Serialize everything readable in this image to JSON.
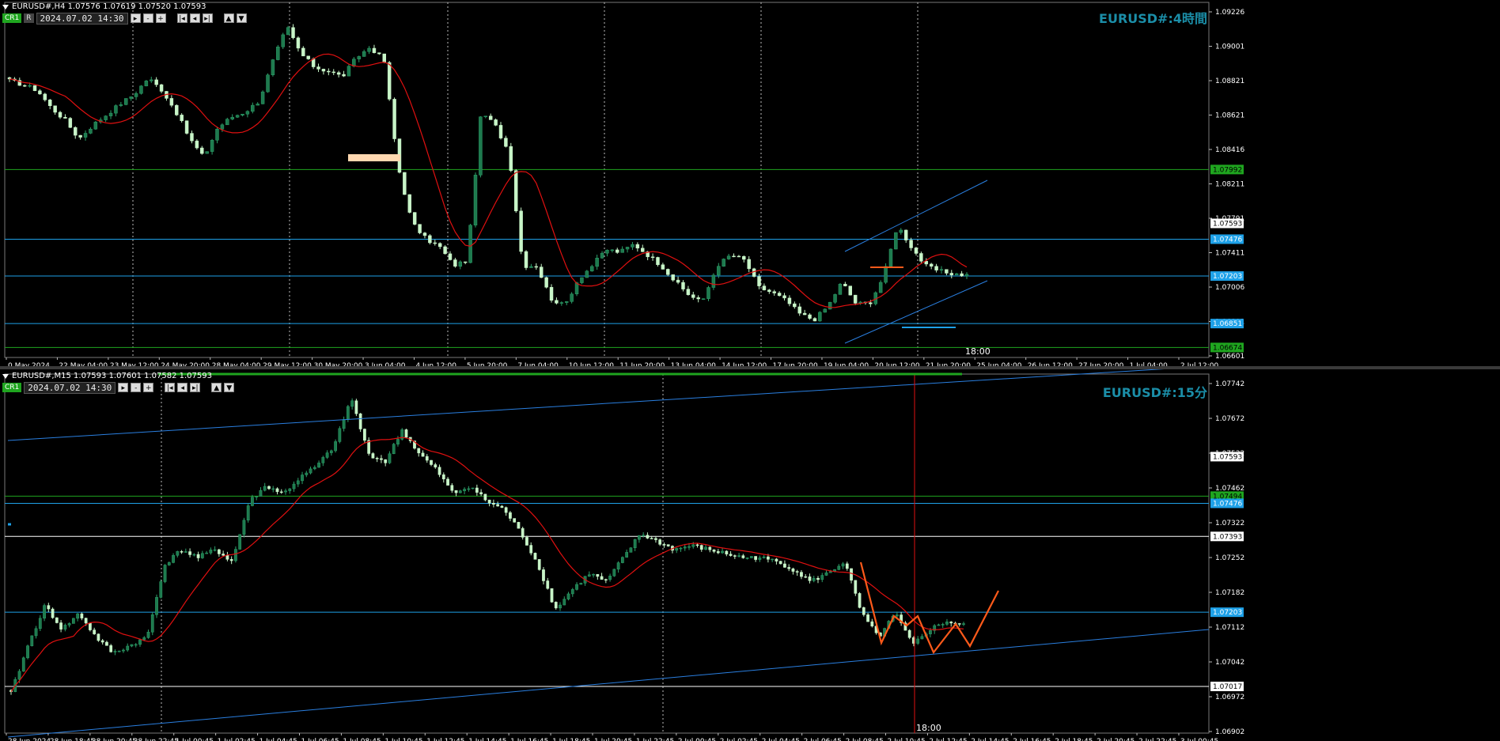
{
  "h4": {
    "symbol_line": "EURUSD#,H4  1.07576 1.07619 1.07520 1.07593",
    "datetime": "2024.07.02  14:30",
    "title": "EURUSD#:4時間",
    "marker_label": "18:00",
    "price_ticks": [
      "1.09226",
      "1.09001",
      "1.08821",
      "1.08621",
      "1.08416",
      "1.08211",
      "1.07791",
      "1.07411",
      "1.07006",
      "1.06801",
      "1.06601"
    ],
    "price_tags": [
      {
        "label": "1.07992",
        "value": 1.07992,
        "color": "#1fa51f",
        "text_color": "#000"
      },
      {
        "label": "1.07593",
        "value": 1.07593,
        "color": "#ffffff",
        "text_color": "#000"
      },
      {
        "label": "1.07476",
        "value": 1.07476,
        "color": "#1ea1e8",
        "text_color": "#fff"
      },
      {
        "label": "1.07203",
        "value": 1.07203,
        "color": "#1ea1e8",
        "text_color": "#fff"
      },
      {
        "label": "1.06851",
        "value": 1.06851,
        "color": "#1ea1e8",
        "text_color": "#fff"
      },
      {
        "label": "1.06674",
        "value": 1.06674,
        "color": "#1fa51f",
        "text_color": "#000"
      }
    ],
    "time_ticks": [
      "0 May 2024",
      "22 May 04:00",
      "23 May 12:00",
      "24 May 20:00",
      "28 May 04:00",
      "29 May 12:00",
      "30 May 20:00",
      "3 Jun 04:00",
      "4 Jun 12:00",
      "5 Jun 20:00",
      "7 Jun 04:00",
      "10 Jun 12:00",
      "11 Jun 20:00",
      "13 Jun 04:00",
      "14 Jun 12:00",
      "17 Jun 20:00",
      "19 Jun 04:00",
      "20 Jun 12:00",
      "21 Jun 20:00",
      "25 Jun 04:00",
      "26 Jun 12:00",
      "27 Jun 20:00",
      "1 Jul 04:00",
      "2 Jul 12:00"
    ]
  },
  "m15": {
    "symbol_line": "EURUSD#,M15  1.07593 1.07601 1.07582 1.07593",
    "datetime": "2024.07.02  14:30",
    "title": "EURUSD#:15分",
    "marker_label": "18:00",
    "price_ticks": [
      "1.07742",
      "1.07672",
      "1.07532",
      "1.07462",
      "1.07322",
      "1.07252",
      "1.07182",
      "1.07112",
      "1.07042",
      "1.06972",
      "1.06902"
    ],
    "price_tags": [
      {
        "label": "1.07593",
        "value": 1.07593,
        "color": "#ffffff",
        "text_color": "#000"
      },
      {
        "label": "1.07494",
        "value": 1.07494,
        "color": "#1fa51f",
        "text_color": "#000"
      },
      {
        "label": "1.07476",
        "value": 1.07476,
        "color": "#1ea1e8",
        "text_color": "#fff"
      },
      {
        "label": "1.07393",
        "value": 1.07393,
        "color": "#ffffff",
        "text_color": "#000"
      },
      {
        "label": "1.07203",
        "value": 1.07203,
        "color": "#1ea1e8",
        "text_color": "#fff"
      },
      {
        "label": "1.07017",
        "value": 1.07017,
        "color": "#ffffff",
        "text_color": "#000"
      }
    ],
    "time_ticks": [
      "28 Jun 2024",
      "28 Jun 18:45",
      "28 Jun 20:45",
      "28 Jun 22:45",
      "1 Jul 00:45",
      "1 Jul 02:45",
      "1 Jul 04:45",
      "1 Jul 06:45",
      "1 Jul 08:45",
      "1 Jul 10:45",
      "1 Jul 12:45",
      "1 Jul 14:45",
      "1 Jul 16:45",
      "1 Jul 18:45",
      "1 Jul 20:45",
      "1 Jul 22:45",
      "2 Jul 00:45",
      "2 Jul 02:45",
      "2 Jul 04:45",
      "2 Jul 06:45",
      "2 Jul 08:45",
      "2 Jul 10:45",
      "2 Jul 12:45",
      "2 Jul 14:45",
      "2 Jul 16:45",
      "2 Jul 18:45",
      "2 Jul 20:45",
      "2 Jul 22:45",
      "3 Jul 00:45"
    ]
  },
  "toolbar": {
    "cr_label": "CR1",
    "r_label": "R"
  },
  "colors": {
    "bull": "#1e7a4e",
    "bear": "#c8f5c8",
    "ma": "#e01010",
    "trend": "#2a7fe0",
    "hline_blue": "#1ea1e8",
    "hline_green": "#1fa51f",
    "zigzag": "#ff5a1a",
    "title": "#1b8ea8"
  },
  "chart_data": [
    {
      "type": "candlestick",
      "title": "EURUSD#:4時間",
      "symbol": "EURUSD#",
      "timeframe": "H4",
      "ylim": [
        1.066,
        1.0923
      ],
      "grid": false,
      "x_tick_labels": [
        "0 May 2024",
        "22 May 04:00",
        "23 May 12:00",
        "24 May 20:00",
        "28 May 04:00",
        "29 May 12:00",
        "30 May 20:00",
        "3 Jun 04:00",
        "4 Jun 12:00",
        "5 Jun 20:00",
        "7 Jun 04:00",
        "10 Jun 12:00",
        "11 Jun 20:00",
        "13 Jun 04:00",
        "14 Jun 12:00",
        "17 Jun 20:00",
        "19 Jun 04:00",
        "20 Jun 12:00",
        "21 Jun 20:00",
        "25 Jun 04:00",
        "26 Jun 12:00",
        "27 Jun 20:00",
        "1 Jul 04:00",
        "2 Jul 12:00"
      ],
      "series": [
        {
          "name": "EURUSD#,H4",
          "anchors": [
            1.0865,
            1.0862,
            1.0858,
            1.0845,
            1.0836,
            1.0822,
            1.0832,
            1.084,
            1.0848,
            1.0855,
            1.0867,
            1.0858,
            1.0842,
            1.0822,
            1.0808,
            1.083,
            1.0838,
            1.0842,
            1.085,
            1.088,
            1.0905,
            1.0885,
            1.0875,
            1.0872,
            1.0868,
            1.0882,
            1.089,
            1.088,
            1.0802,
            1.076,
            1.0748,
            1.0742,
            1.0728,
            1.0732,
            1.0842,
            1.0832,
            1.0812,
            1.0728,
            1.0728,
            1.0704,
            1.0698,
            1.0718,
            1.0728,
            1.074,
            1.0738,
            1.0744,
            1.0736,
            1.0728,
            1.0716,
            1.0706,
            1.0702,
            1.0728,
            1.0736,
            1.0732,
            1.0712,
            1.0708,
            1.0702,
            1.0692,
            1.0688,
            1.0698,
            1.0716,
            1.07,
            1.07,
            1.072,
            1.0758,
            1.0742,
            1.0728,
            1.0724,
            1.0722,
            1.0721
          ]
        }
      ],
      "horizontal_lines": [
        1.07992,
        1.07476,
        1.07203,
        1.06851,
        1.06674
      ],
      "last_price": 1.07593
    },
    {
      "type": "candlestick",
      "title": "EURUSD#:15分",
      "symbol": "EURUSD#",
      "timeframe": "M15",
      "ylim": [
        1.069,
        1.078
      ],
      "grid": false,
      "x_tick_labels": [
        "28 Jun 2024",
        "28 Jun 18:45",
        "28 Jun 20:45",
        "28 Jun 22:45",
        "1 Jul 00:45",
        "1 Jul 02:45",
        "1 Jul 04:45",
        "1 Jul 06:45",
        "1 Jul 08:45",
        "1 Jul 10:45",
        "1 Jul 12:45",
        "1 Jul 14:45",
        "1 Jul 16:45",
        "1 Jul 18:45",
        "1 Jul 20:45",
        "1 Jul 22:45",
        "2 Jul 00:45",
        "2 Jul 02:45",
        "2 Jul 04:45",
        "2 Jul 06:45",
        "2 Jul 08:45",
        "2 Jul 10:45",
        "2 Jul 12:45",
        "2 Jul 14:45",
        "2 Jul 16:45",
        "2 Jul 18:45",
        "2 Jul 20:45",
        "2 Jul 22:45",
        "3 Jul 00:45"
      ],
      "series": [
        {
          "name": "EURUSD#,M15",
          "anchors": [
            1.07,
            1.0712,
            1.0722,
            1.0716,
            1.072,
            1.0714,
            1.071,
            1.0712,
            1.0714,
            1.0732,
            1.0736,
            1.0734,
            1.0736,
            1.0733,
            1.0748,
            1.0752,
            1.075,
            1.0754,
            1.0757,
            1.0762,
            1.0774,
            1.076,
            1.0758,
            1.0766,
            1.076,
            1.0756,
            1.075,
            1.0752,
            1.0748,
            1.0746,
            1.074,
            1.0732,
            1.0721,
            1.0726,
            1.073,
            1.0728,
            1.0734,
            1.074,
            1.0738,
            1.0736,
            1.0737,
            1.0736,
            1.0735,
            1.0734,
            1.0734,
            1.0733,
            1.0731,
            1.0728,
            1.073,
            1.0733,
            1.072,
            1.0714,
            1.072,
            1.0712,
            1.0716,
            1.0718,
            1.0717
          ]
        }
      ],
      "horizontal_lines": [
        1.07494,
        1.07476,
        1.07393,
        1.07203,
        1.07017
      ],
      "last_price": 1.07593
    }
  ]
}
